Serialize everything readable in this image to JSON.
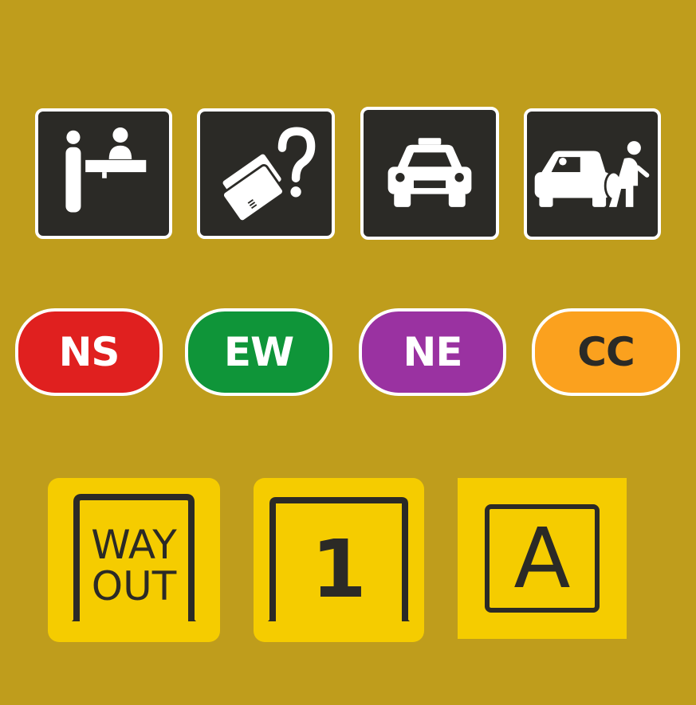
{
  "colors": {
    "background": "#bf9d1c",
    "pictogram_bg": "#2b2a26",
    "pictogram_border": "#ffffff",
    "sign_yellow": "#f5cc00"
  },
  "pictograms": [
    {
      "icon": "customer-service-counter-icon"
    },
    {
      "icon": "lost-card-question-icon"
    },
    {
      "icon": "taxi-icon"
    },
    {
      "icon": "pick-up-drop-off-icon"
    }
  ],
  "lines": [
    {
      "code": "NS",
      "bg": "#e0201f",
      "fg": "#ffffff"
    },
    {
      "code": "EW",
      "bg": "#0f9539",
      "fg": "#ffffff"
    },
    {
      "code": "NE",
      "bg": "#9a32a1",
      "fg": "#ffffff"
    },
    {
      "code": "CC",
      "bg": "#fba11e",
      "fg": "#2b2a26"
    }
  ],
  "exits": {
    "way_out_line1": "WAY",
    "way_out_line2": "OUT",
    "exit_number": "1",
    "exit_letter": "A"
  }
}
